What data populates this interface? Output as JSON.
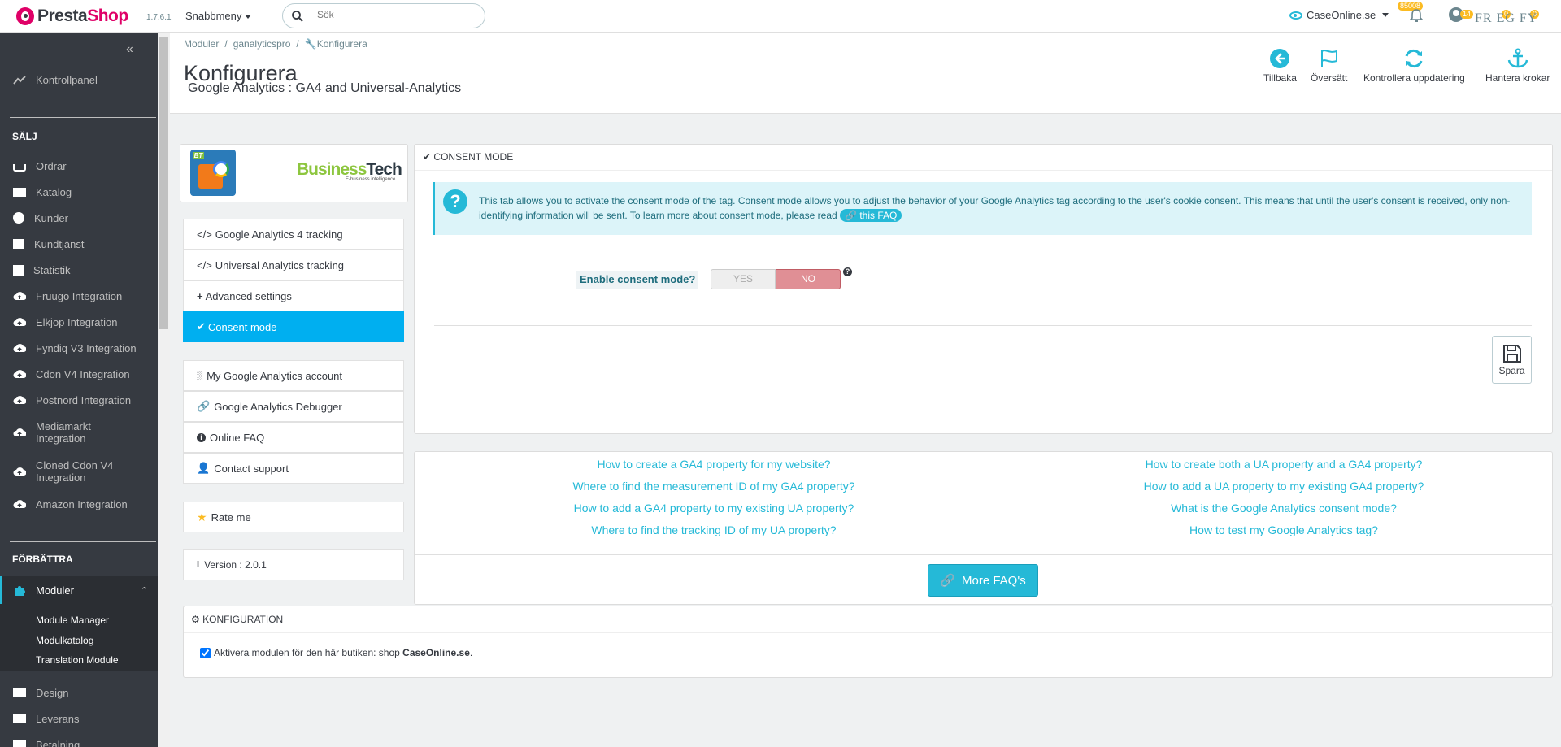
{
  "header": {
    "logo_part1": "Presta",
    "logo_part2": "Shop",
    "version": "1.7.6.1",
    "quick_menu": "Snabbmeny",
    "search_placeholder": "Sök",
    "shop_name": "CaseOnline.se",
    "notif_badge_shop": "85008",
    "notif_badge_user": "14",
    "lang_links": "FR  EG  FY",
    "lang_badge1": "0",
    "lang_badge2": "0"
  },
  "sidebar": {
    "dashboard": "Kontrollpanel",
    "section_sell": "SÄLJ",
    "sell_items": [
      "Ordrar",
      "Katalog",
      "Kunder",
      "Kundtjänst",
      "Statistik",
      "Fruugo Integration",
      "Elkjop Integration",
      "Fyndiq V3 Integration",
      "Cdon V4 Integration",
      "Postnord Integration",
      "Mediamarkt\nIntegration",
      "Cloned Cdon V4\nIntegration",
      "Amazon Integration"
    ],
    "section_improve": "FÖRBÄTTRA",
    "modules": "Moduler",
    "module_sub": [
      "Module Manager",
      "Modulkatalog",
      "Translation Module"
    ],
    "design": "Design",
    "shipping": "Leverans",
    "payment": "Betalning"
  },
  "breadcrumb": [
    "Moduler",
    "ganalyticspro",
    "Konfigurera"
  ],
  "page": {
    "title": "Konfigurera",
    "subtitle": "Google Analytics : GA4 and Universal-Analytics"
  },
  "toolbar": {
    "back": "Tillbaka",
    "translate": "Översätt",
    "check_update": "Kontrollera uppdatering",
    "hooks": "Hantera krokar"
  },
  "module": {
    "brand_name_1": "Business",
    "brand_name_2": "Tech",
    "brand_tagline": "E-business intelligence",
    "menu": [
      "Google Analytics 4 tracking",
      "Universal Analytics tracking",
      "Advanced settings",
      "Consent mode"
    ],
    "links": [
      "My Google Analytics account",
      "Google Analytics Debugger",
      "Online FAQ",
      "Contact support"
    ],
    "rate": "Rate me",
    "version": "Version : 2.0.1"
  },
  "consent": {
    "heading": "CONSENT MODE",
    "info": "This tab allows you to activate the consent mode of the tag. Consent mode allows you to adjust the behavior of your Google Analytics tag according to the user's cookie consent. This means that until the user's consent is received, only non-identifying information will be sent. To learn more about consent mode, please read",
    "faq_link": "this FAQ",
    "enable_label": "Enable consent mode?",
    "yes": "YES",
    "no": "NO",
    "save": "Spara"
  },
  "faq": {
    "left": [
      "How to create a GA4 property for my website?",
      "Where to find the measurement ID of my GA4 property?",
      "How to add a GA4 property to my existing UA property?",
      "Where to find the tracking ID of my UA property?"
    ],
    "right": [
      "How to create both a UA property and a GA4 property?",
      "How to add a UA property to my existing GA4 property?",
      "What is the Google Analytics consent mode?",
      "How to test my Google Analytics tag?"
    ],
    "more": "More FAQ's"
  },
  "config": {
    "heading": "KONFIGURATION",
    "checkbox_text": "Aktivera modulen för den här butiken: shop",
    "shop_bold": "CaseOnline.se",
    "period": "."
  },
  "colors": {
    "accent": "#25b9d7",
    "sidebar": "#363a41",
    "active_menu": "#00aff0",
    "no_toggle": "#e08f95"
  }
}
